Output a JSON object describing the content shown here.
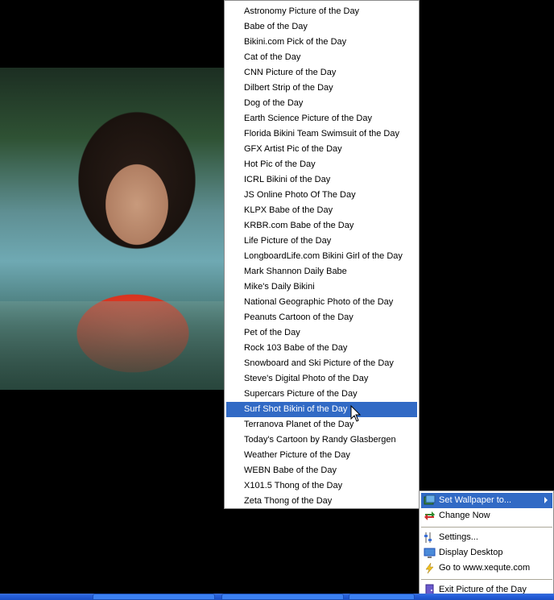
{
  "picture_menu": {
    "items": [
      "Astronomy Picture of the Day",
      "Babe of the Day",
      "Bikini.com Pick of the Day",
      "Cat of the Day",
      "CNN Picture of the Day",
      "Dilbert Strip of the Day",
      "Dog of the Day",
      "Earth Science Picture of the Day",
      "Florida Bikini Team Swimsuit of the Day",
      "GFX Artist Pic of the Day",
      "Hot Pic of the Day",
      "ICRL Bikini of the Day",
      "JS Online Photo Of The Day",
      "KLPX Babe of the Day",
      "KRBR.com Babe of the Day",
      "Life Picture of the Day",
      "LongboardLife.com Bikini Girl of the Day",
      "Mark Shannon Daily Babe",
      "Mike's Daily Bikini",
      "National Geographic Photo of the Day",
      "Peanuts Cartoon of the Day",
      "Pet of the Day",
      "Rock 103 Babe of the Day",
      "Snowboard and Ski Picture of the Day",
      "Steve's Digital Photo of the Day",
      "Supercars Picture of the Day",
      "Surf Shot Bikini of the Day",
      "Terranova Planet of the Day",
      "Today's Cartoon by Randy Glasbergen",
      "Weather Picture of the Day",
      "WEBN Babe of the Day",
      "X101.5 Thong of the Day",
      "Zeta Thong of the Day"
    ],
    "selected": "Surf Shot Bikini of the Day"
  },
  "tray_menu": {
    "set_wallpaper": "Set Wallpaper to...",
    "change_now": "Change Now",
    "settings": "Settings...",
    "display_desktop": "Display Desktop",
    "go_to_site": "Go to www.xequte.com",
    "exit": "Exit Picture of the Day"
  },
  "colors": {
    "highlight": "#316ac5",
    "taskbar": "#245edb"
  }
}
